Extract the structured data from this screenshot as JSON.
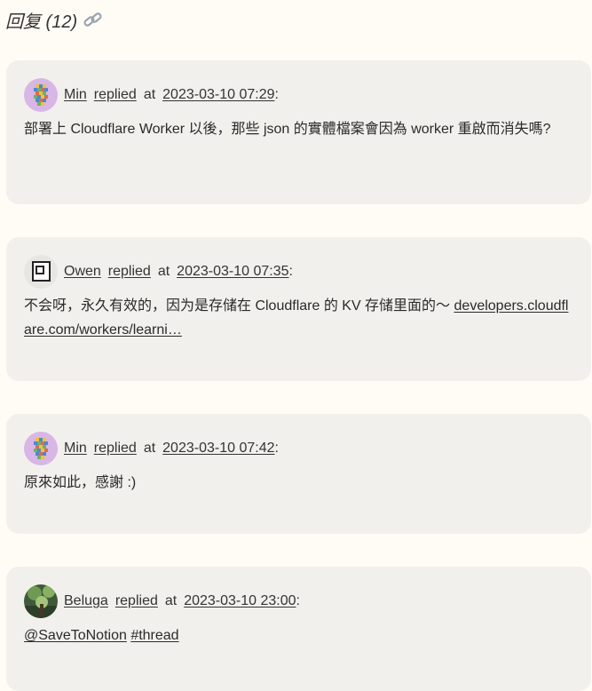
{
  "section": {
    "title": "回复 (12)",
    "link_icon": "link-icon"
  },
  "replies": [
    {
      "author": "Min",
      "avatar": "pixel-avatar",
      "action": "replied",
      "at": "at",
      "timestamp": "2023-03-10 07:29",
      "colon": ":",
      "body": "部署上 Cloudflare Worker 以後，那些 json 的實體檔案會因為 worker 重啟而消失嗎?"
    },
    {
      "author": "Owen",
      "avatar": "square-avatar",
      "action": "replied",
      "at": "at",
      "timestamp": "2023-03-10 07:35",
      "colon": ":",
      "body": "不会呀，永久有效的，因为是存储在 Cloudflare 的 KV 存储里面的～ ",
      "link_text": "developers.cloudflare.com/workers/learni…"
    },
    {
      "author": "Min",
      "avatar": "pixel-avatar",
      "action": "replied",
      "at": "at",
      "timestamp": "2023-03-10 07:42",
      "colon": ":",
      "body": "原來如此，感謝 :)"
    },
    {
      "author": "Beluga",
      "avatar": "photo-avatar",
      "action": "replied",
      "at": "at",
      "timestamp": "2023-03-10 23:00",
      "colon": ":",
      "mention": "@SaveToNotion",
      "hashtag": "#thread"
    }
  ]
}
